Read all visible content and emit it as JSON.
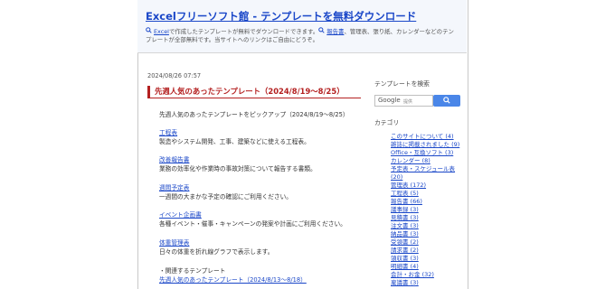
{
  "site": {
    "title": "Excelフリーソフト館 - テンプレートを無料ダウンロード",
    "desc_line1_link": "Excel",
    "desc_line1_text": "で作成したテンプレートが無料でダウンロードできます。",
    "desc_line1_link2": "報告書",
    "desc_line1_tail": "、管理表、張り紙、カレンダーなどのテン",
    "desc_line2": "プレートが全部無料です。当サイトへのリンクはご自由にどうぞ。"
  },
  "post": {
    "date": "2024/08/26 07:57",
    "title": "先週人気のあったテンプレート（2024/8/19～8/25）",
    "intro": "先週人気のあったテンプレートをピックアップ（2024/8/19～8/25）",
    "entries": [
      {
        "link": "工程表",
        "text": "製造やシステム開発、工事、建築などに使える工程表。"
      },
      {
        "link": "改善報告書",
        "text": "業務の効率化や作業時の事故対策について報告する書類。"
      },
      {
        "link": "週間予定表",
        "text": "一週間の大まかな予定の確認にご利用ください。"
      },
      {
        "link": "イベント企画書",
        "text": "各種イベント・催事・キャンペーンの発案や計画にご利用ください。"
      },
      {
        "link": "体重管理表",
        "text": "日々の体重を折れ線グラフで表示します。"
      }
    ],
    "related_label": "・関連するテンプレート",
    "related_link": "先週人気のあったテンプレート（2024/8/13～8/18）"
  },
  "sidebar": {
    "search_title": "テンプレートを検索",
    "search_google": "Google",
    "search_placeholder": "提供",
    "category_title": "カテゴリ",
    "categories": [
      "このサイトについて (4)",
      "雑誌に掲載されました (9)",
      "Office・互換ソフト (3)",
      "カレンダー (8)",
      "予定表・スケジュール表",
      "(20)",
      "管理表 (172)",
      "工程表 (5)",
      "報告書 (66)",
      "議事録 (3)",
      "見積書 (3)",
      "注文書 (3)",
      "納品書 (3)",
      "受領書 (2)",
      "請求書 (2)",
      "領収書 (3)",
      "明細書 (4)",
      "会計・お金 (32)",
      "稟議書 (3)"
    ]
  }
}
